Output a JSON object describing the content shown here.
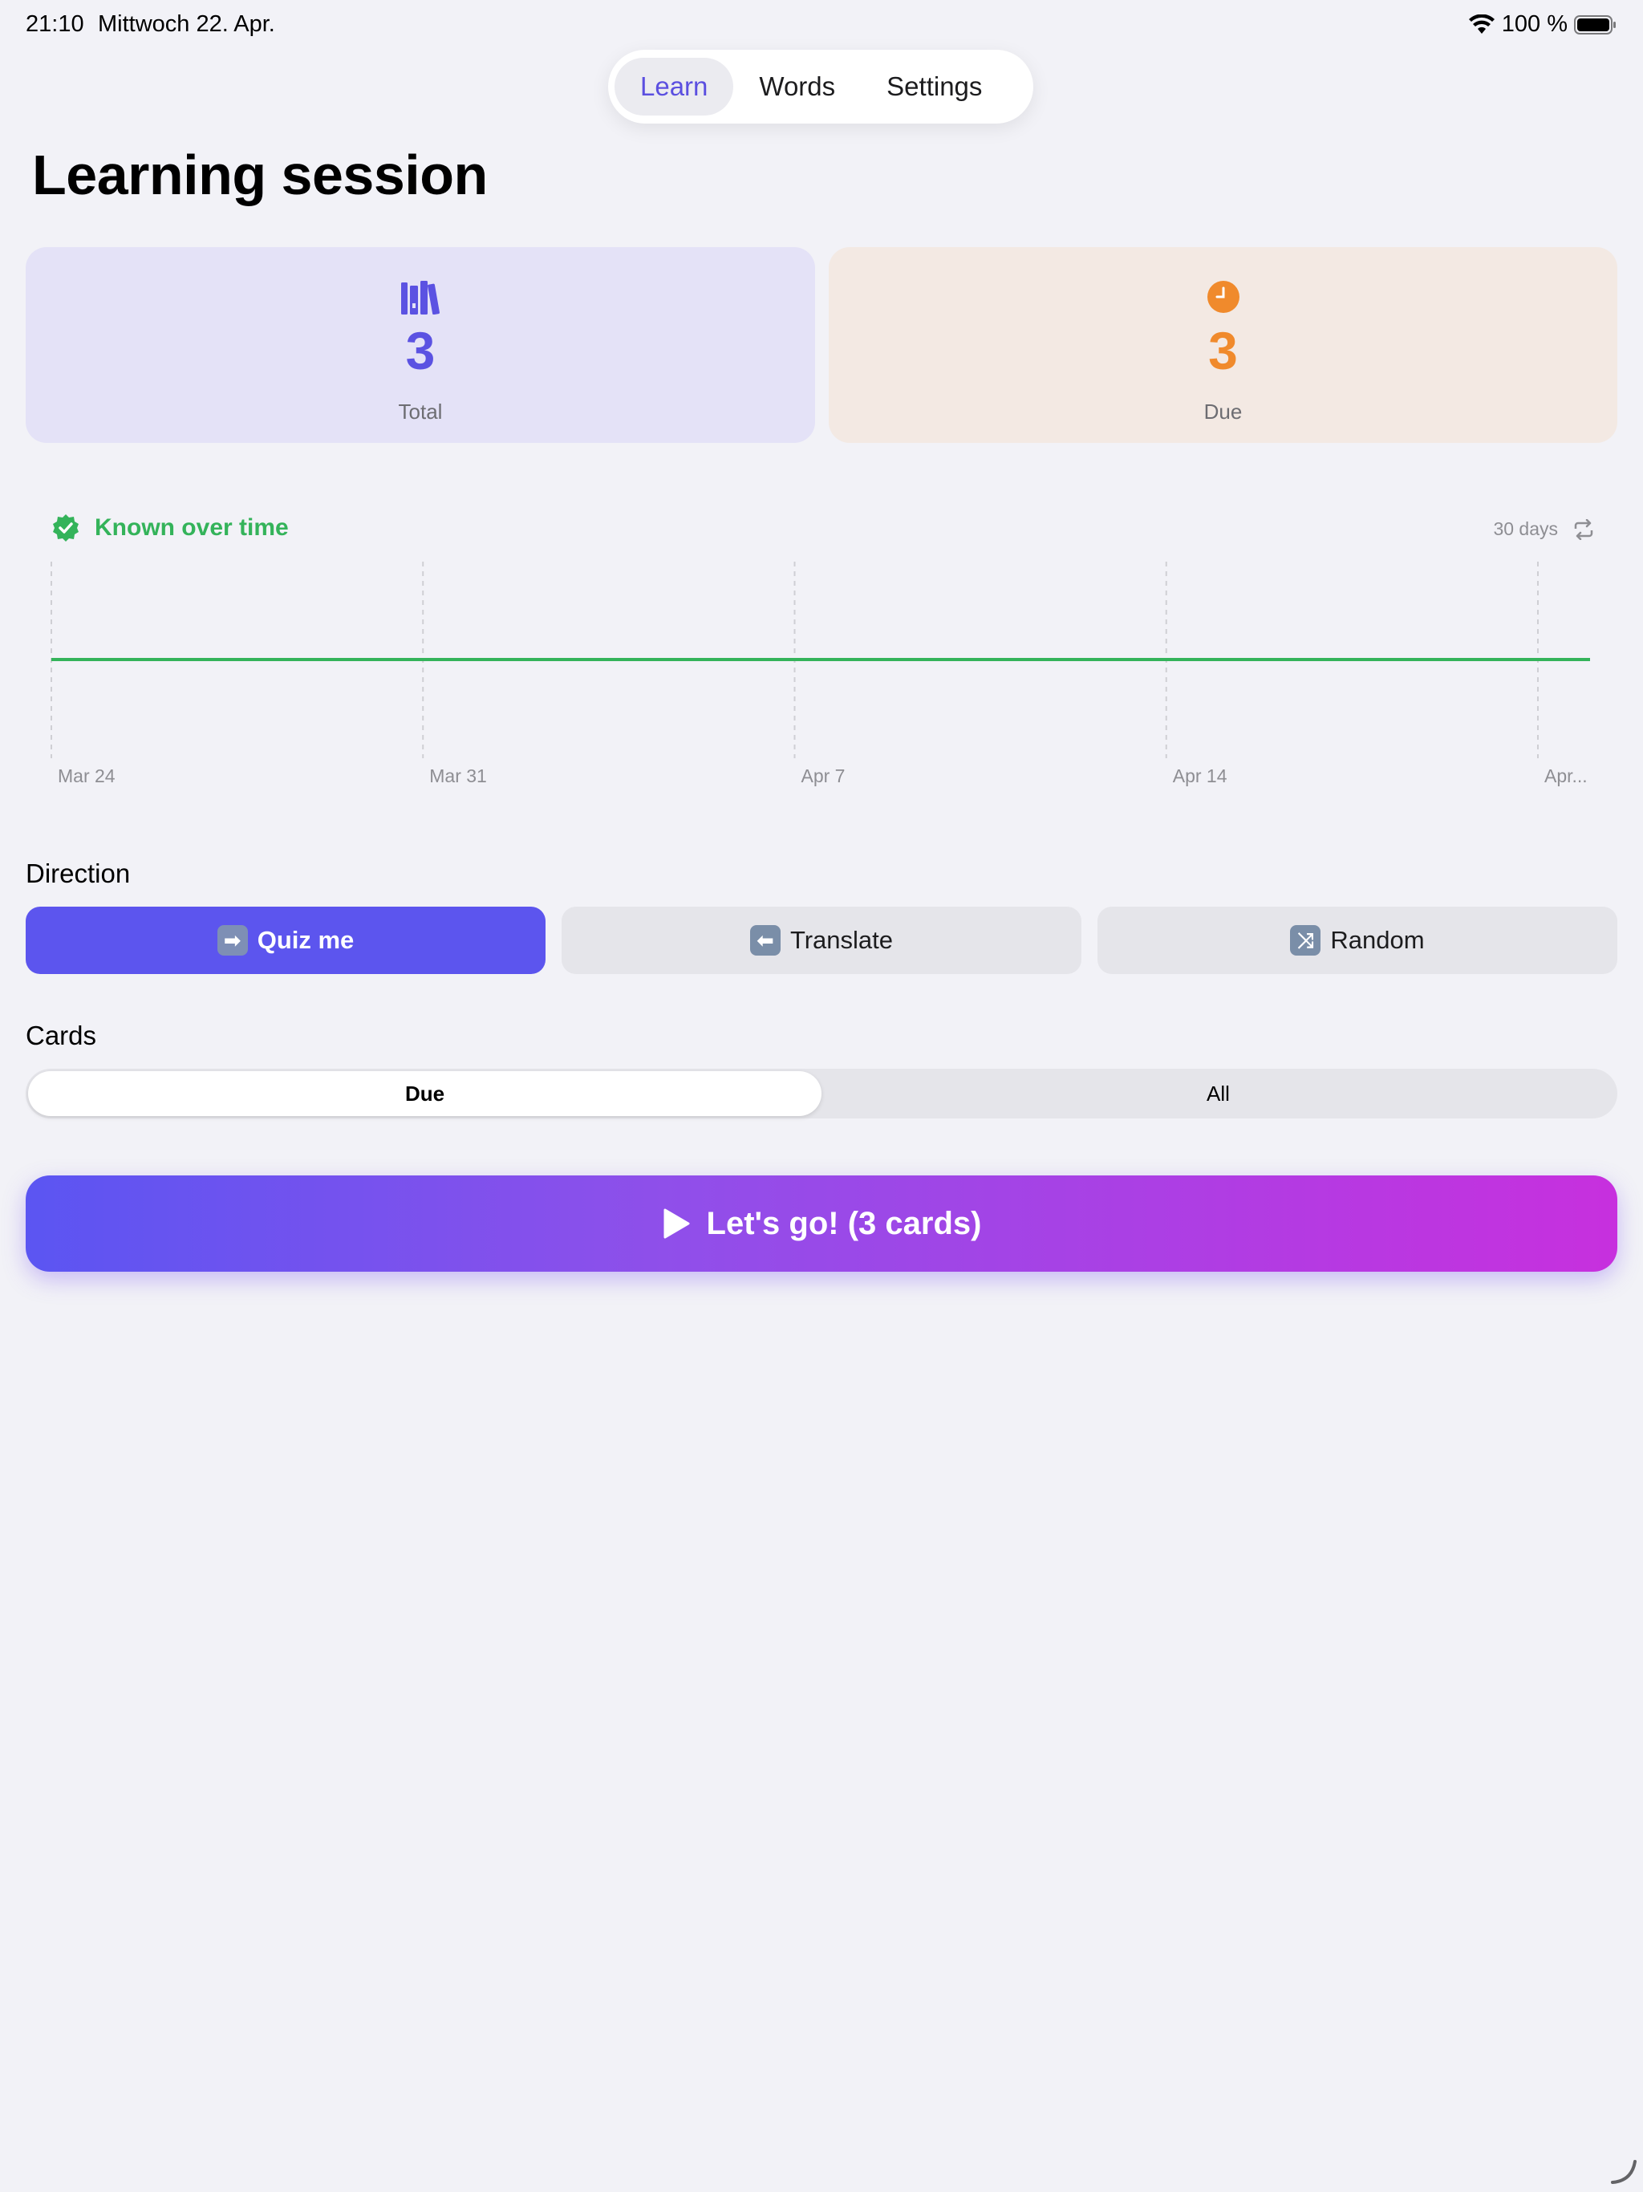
{
  "status_bar": {
    "time": "21:10",
    "date": "Mittwoch 22. Apr.",
    "battery": "100 %"
  },
  "nav": {
    "tabs": [
      {
        "label": "Learn",
        "active": true
      },
      {
        "label": "Words",
        "active": false
      },
      {
        "label": "Settings",
        "active": false
      }
    ]
  },
  "page": {
    "title": "Learning session"
  },
  "stats": {
    "total": {
      "value": "3",
      "label": "Total",
      "icon": "books-icon",
      "color": "#5b52e2"
    },
    "due": {
      "value": "3",
      "label": "Due",
      "icon": "clock-icon",
      "color": "#f08a2c"
    }
  },
  "chart_header": {
    "title": "Known over time",
    "range": "30 days"
  },
  "chart_data": {
    "type": "line",
    "x": [
      "Mar 24",
      "Mar 31",
      "Apr 7",
      "Apr 14",
      "Apr..."
    ],
    "series": [
      {
        "values": [
          3,
          3,
          3,
          3,
          3
        ],
        "color": "#34b35a"
      }
    ],
    "title": "Known over time",
    "xlabel": "",
    "ylabel": "",
    "grid": "vertical dashed"
  },
  "direction": {
    "label": "Direction",
    "options": [
      {
        "label": "Quiz me",
        "emoji": "➡",
        "active": true
      },
      {
        "label": "Translate",
        "emoji": "⬅",
        "active": false
      },
      {
        "label": "Random",
        "emoji": "⤨",
        "active": false
      }
    ]
  },
  "cards": {
    "label": "Cards",
    "options": [
      {
        "label": "Due",
        "active": true
      },
      {
        "label": "All",
        "active": false
      }
    ]
  },
  "start": {
    "label": "Let's go! (3 cards)"
  }
}
